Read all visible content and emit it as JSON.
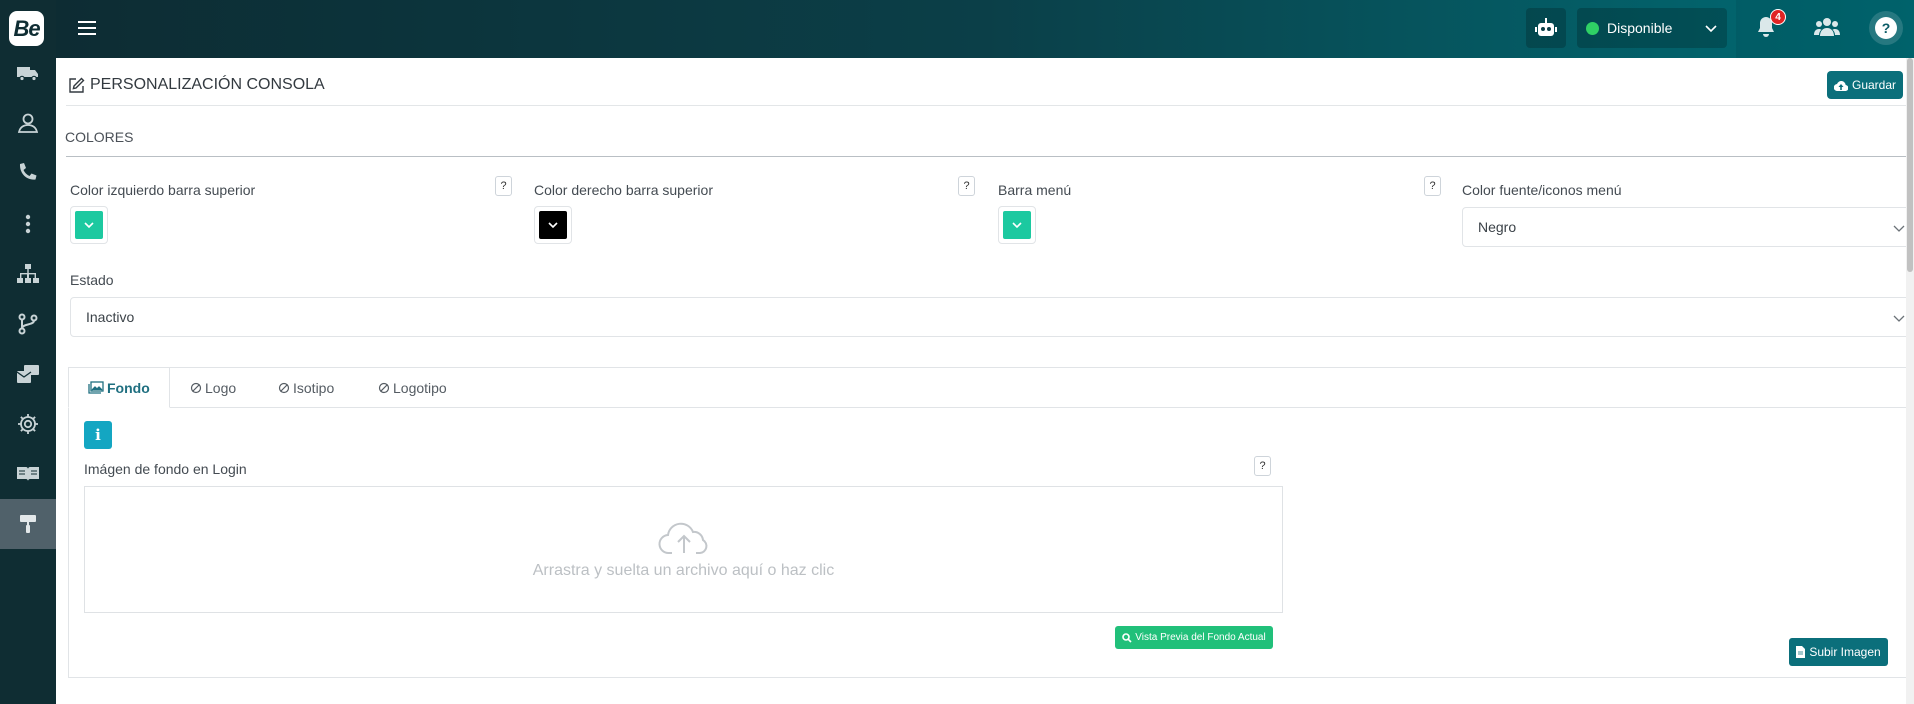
{
  "app": {
    "logo_text": "Be"
  },
  "sidebar": {
    "items": [
      {
        "icon": "truck-icon"
      },
      {
        "icon": "user-icon"
      },
      {
        "icon": "phone-icon"
      },
      {
        "icon": "more-vertical-icon"
      },
      {
        "icon": "sitemap-icon"
      },
      {
        "icon": "branch-icon"
      },
      {
        "icon": "mail-bulk-icon"
      },
      {
        "icon": "gear-icon"
      },
      {
        "icon": "book-icon"
      },
      {
        "icon": "paint-roller-icon",
        "active": true
      }
    ]
  },
  "topbar": {
    "status_label": "Disponible",
    "status_color": "#2fd065",
    "notifications_count": "4"
  },
  "page": {
    "title": "PERSONALIZACIÓN CONSOLA",
    "save_label": "Guardar",
    "section_title": "COLORES"
  },
  "colors": {
    "left_bar_label": "Color izquierdo barra superior",
    "left_bar_color": "#1cc9a0",
    "right_bar_label": "Color derecho barra superior",
    "right_bar_color": "#000000",
    "menu_bar_label": "Barra menú",
    "menu_bar_color": "#1cc9a0",
    "menu_font_label": "Color fuente/iconos menú",
    "menu_font_value": "Negro",
    "help_symbol": "?"
  },
  "estado": {
    "label": "Estado",
    "value": "Inactivo"
  },
  "tabs": [
    {
      "label": "Fondo",
      "active": true
    },
    {
      "label": "Logo"
    },
    {
      "label": "Isotipo"
    },
    {
      "label": "Logotipo"
    }
  ],
  "fondo": {
    "info_symbol": "i",
    "field_label": "Imágen de fondo en Login",
    "dropzone_text": "Arrastra y suelta un archivo aquí o haz clic",
    "preview_label": "Vista Previa del Fondo Actual",
    "upload_label": "Subir Imagen"
  }
}
